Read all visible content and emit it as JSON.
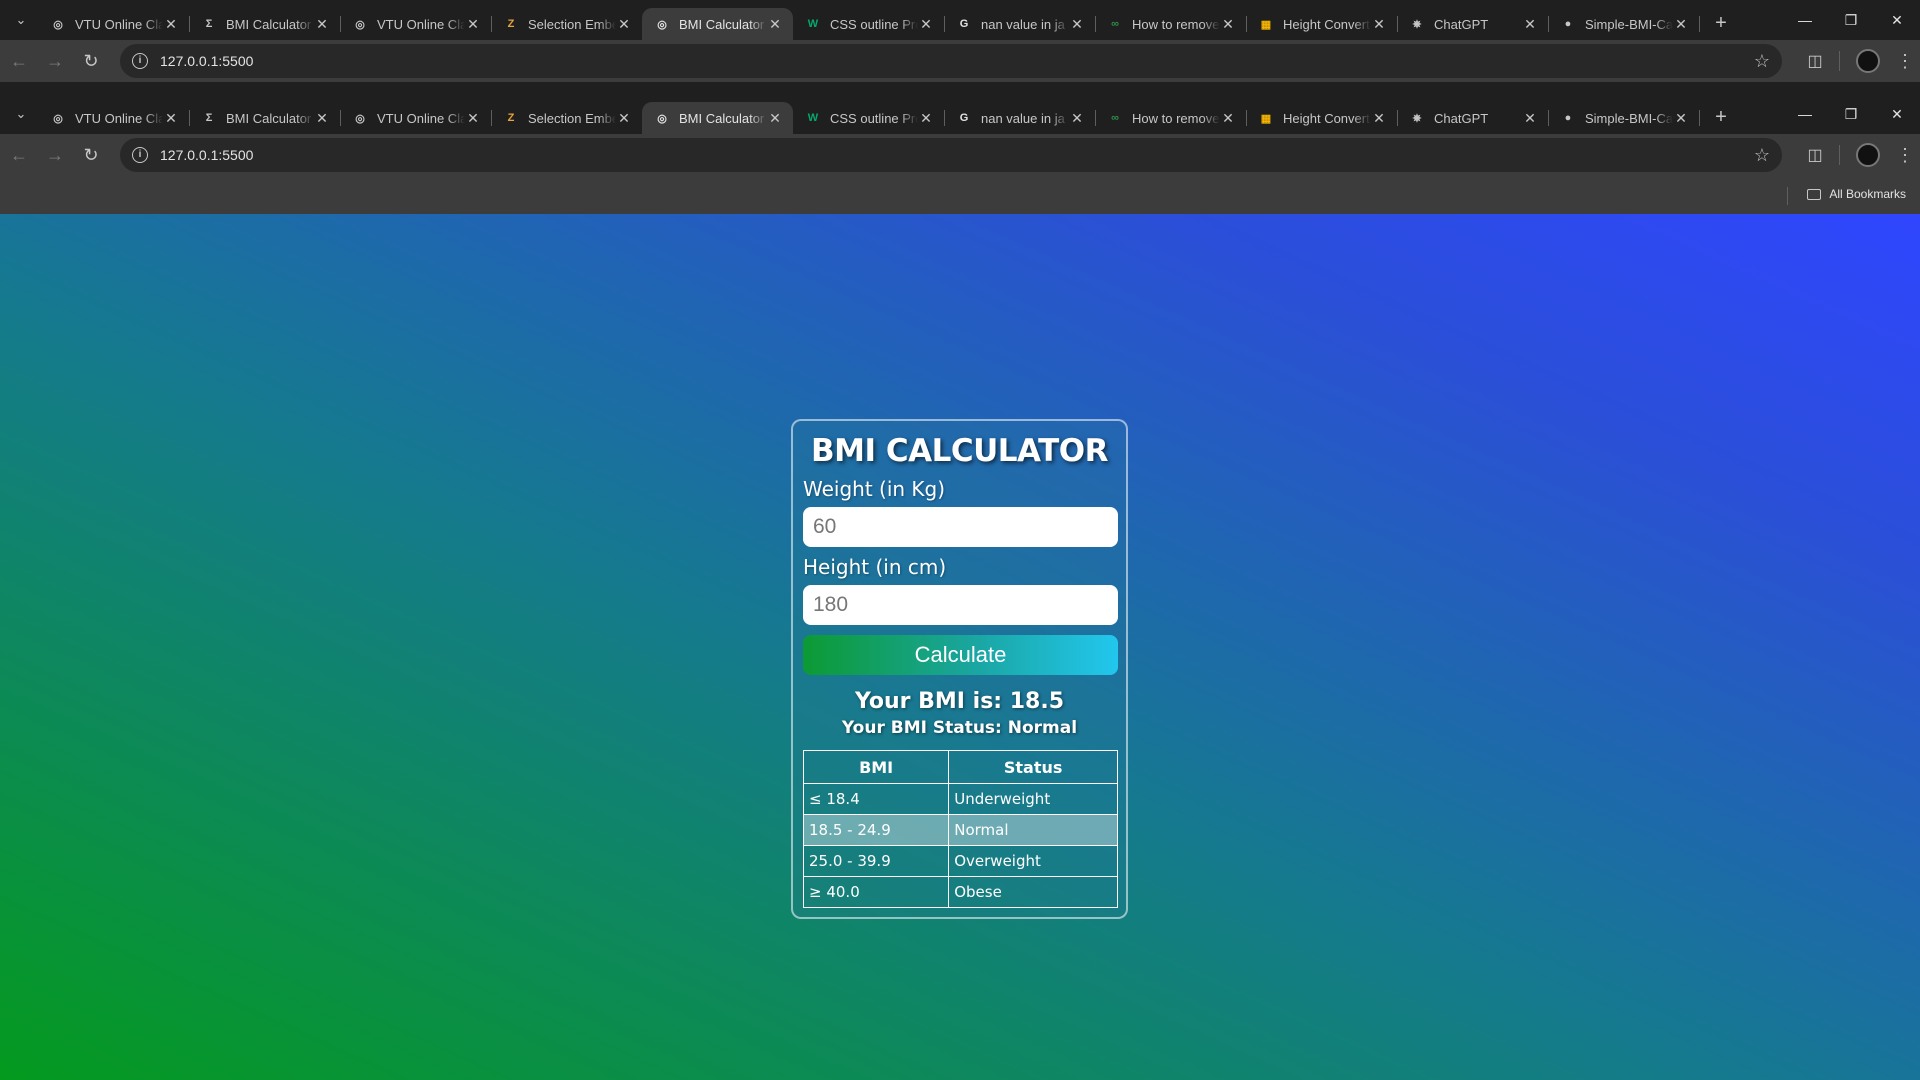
{
  "browser": {
    "tabs": [
      {
        "title": "VTU Online Cla",
        "icon": "vtu-icon",
        "active": false
      },
      {
        "title": "BMI Calculator",
        "icon": "sigma-icon",
        "active": false
      },
      {
        "title": "VTU Online Cla",
        "icon": "vtu-icon",
        "active": false
      },
      {
        "title": "Selection Embe",
        "icon": "zoho-icon",
        "active": false
      },
      {
        "title": "BMI Calculator",
        "icon": "globe-icon",
        "active": true
      },
      {
        "title": "CSS outline Pro",
        "icon": "w3-icon",
        "active": false
      },
      {
        "title": "nan value in ja",
        "icon": "google-icon",
        "active": false
      },
      {
        "title": "How to remove",
        "icon": "gfg-icon",
        "active": false
      },
      {
        "title": "Height Convert",
        "icon": "converter-icon",
        "active": false
      },
      {
        "title": "ChatGPT",
        "icon": "chatgpt-icon",
        "active": false
      },
      {
        "title": "Simple-BMI-Ca",
        "icon": "github-icon",
        "active": false
      }
    ],
    "url": "127.0.0.1:5500",
    "bookmarks_label": "All Bookmarks"
  },
  "app": {
    "title": "BMI CALCULATOR",
    "weight_label": "Weight (in Kg)",
    "weight_value": "60",
    "height_label": "Height (in cm)",
    "height_value": "180",
    "button_label": "Calculate",
    "bmi_result": "Your BMI is: 18.5",
    "bmi_status": "Your BMI Status: Normal",
    "table": {
      "headers": [
        "BMI",
        "Status"
      ],
      "rows": [
        [
          "≤ 18.4",
          "Underweight"
        ],
        [
          "18.5 - 24.9",
          "Normal"
        ],
        [
          "25.0 - 39.9",
          "Overweight"
        ],
        [
          "≥ 40.0",
          "Obese"
        ]
      ],
      "highlighted_row": 1
    }
  },
  "colors": {
    "gradient_start": "#049a1e",
    "gradient_end": "#2f46ff",
    "button_start": "#0c9a34",
    "button_end": "#22c7ee"
  }
}
